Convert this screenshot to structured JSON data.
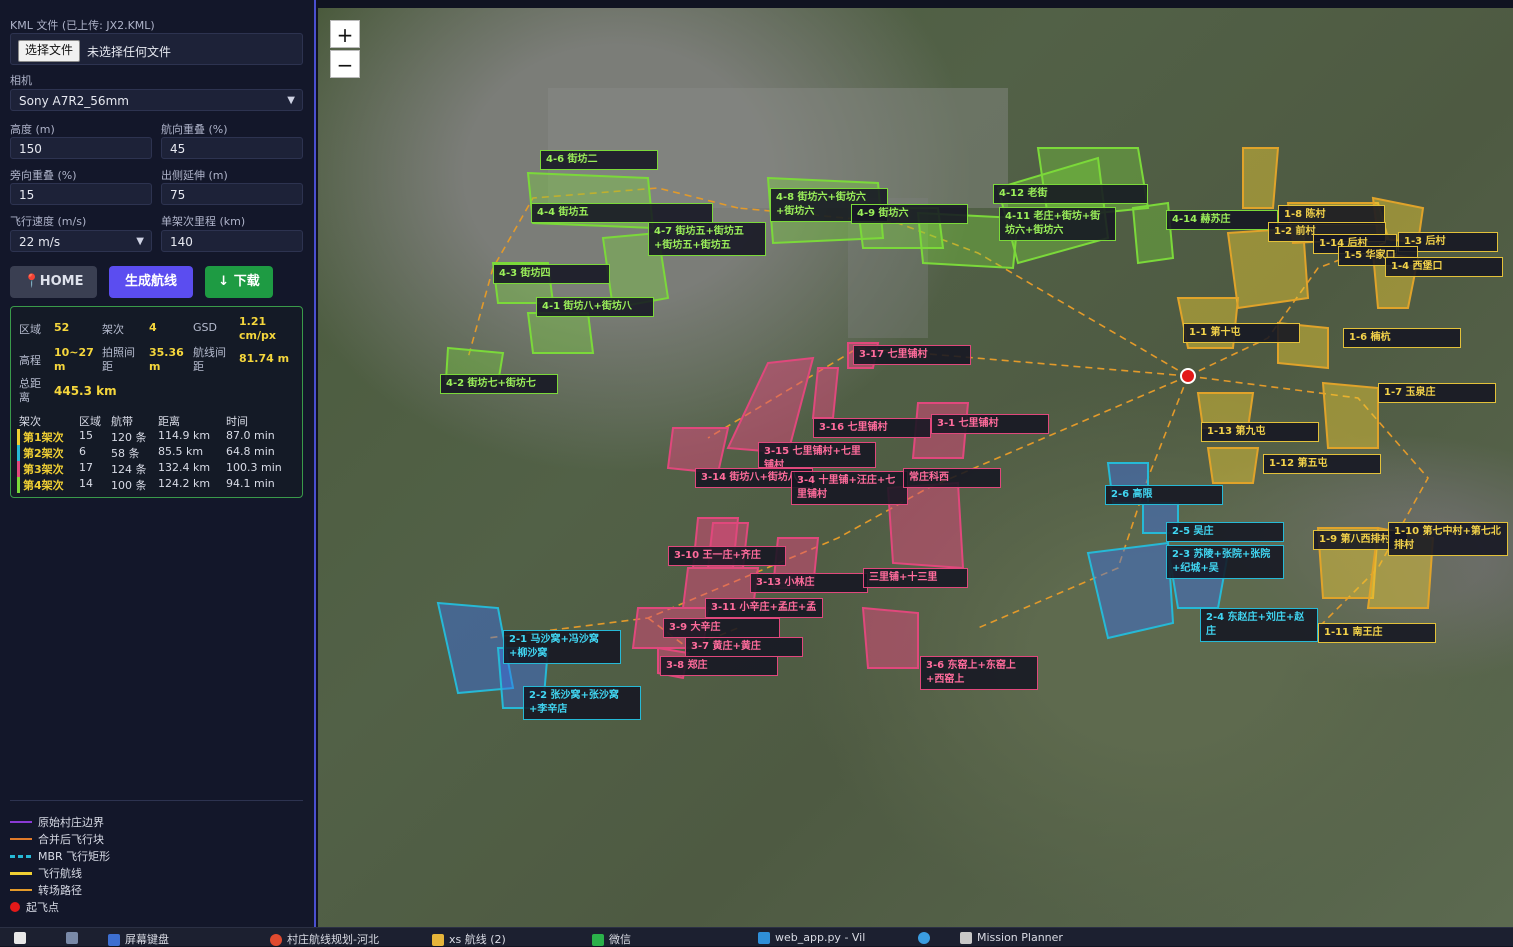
{
  "sidebar": {
    "kml_label": "KML 文件 (已上传: JX2.KML)",
    "file_button": "选择文件",
    "file_status": "未选择任何文件",
    "camera_label": "相机",
    "camera_value": "Sony A7R2_56mm",
    "altitude_label": "高度 (m)",
    "altitude_value": "150",
    "forward_overlap_label": "航向重叠 (%)",
    "forward_overlap_value": "45",
    "side_overlap_label": "旁向重叠 (%)",
    "side_overlap_value": "15",
    "extension_label": "出侧延伸 (m)",
    "extension_value": "75",
    "speed_label": "飞行速度 (m/s)",
    "speed_value": "22 m/s",
    "range_label": "单架次里程 (km)",
    "range_value": "140",
    "home_button": "HOME",
    "generate_button": "生成航线",
    "download_button": "↓ 下载"
  },
  "stats": {
    "zones_label": "区域",
    "zones_value": "52",
    "sorties_label": "架次",
    "sorties_value": "4",
    "gsd_label": "GSD",
    "gsd_value": "1.21 cm/px",
    "height_label": "高程",
    "height_value": "10~27 m",
    "photo_interval_label": "拍照间距",
    "photo_interval_value": "35.36 m",
    "line_spacing_label": "航线间距",
    "line_spacing_value": "81.74 m",
    "total_label": "总距离",
    "total_value": "445.3 km",
    "table_headers": [
      "架次",
      "区域",
      "航带",
      "距离",
      "时间"
    ],
    "rows": [
      {
        "name": "第1架次",
        "zones": "15",
        "strips": "120 条",
        "distance": "114.9 km",
        "time": "87.0 min",
        "color": "#f0cf33"
      },
      {
        "name": "第2架次",
        "zones": "6",
        "strips": "58 条",
        "distance": "85.5 km",
        "time": "64.8 min",
        "color": "#26b9d6"
      },
      {
        "name": "第3架次",
        "zones": "17",
        "strips": "124 条",
        "distance": "132.4 km",
        "time": "100.3 min",
        "color": "#e0487c"
      },
      {
        "name": "第4架次",
        "zones": "14",
        "strips": "100 条",
        "distance": "124.2 km",
        "time": "94.1 min",
        "color": "#7bd93a"
      }
    ]
  },
  "legend": [
    {
      "label": "原始村庄边界",
      "color": "#8a3ad6"
    },
    {
      "label": "合并后飞行块",
      "color": "#e07a2a"
    },
    {
      "label": "MBR 飞行矩形",
      "color": "#26b9d6"
    },
    {
      "label": "飞行航线",
      "color": "#f0cf33"
    },
    {
      "label": "转场路径",
      "color": "#e39a2a"
    },
    {
      "label": "起飞点",
      "color": "#e31919"
    }
  ],
  "map": {
    "zoom_in": "+",
    "zoom_out": "−",
    "labels": [
      {
        "text": "4-6 街坊二",
        "c": "g"
      },
      {
        "text": "4-4 街坊五",
        "c": "g"
      },
      {
        "text": "4-7 街坊五+街坊五+街坊五+街坊五",
        "c": "g"
      },
      {
        "text": "4-8 街坊六+街坊六+街坊六",
        "c": "g"
      },
      {
        "text": "4-9 街坊六",
        "c": "g"
      },
      {
        "text": "4-12 老街",
        "c": "g"
      },
      {
        "text": "4-11 老庄+街坊+街坊六+街坊六",
        "c": "g"
      },
      {
        "text": "4-14 赫苏庄",
        "c": "g"
      },
      {
        "text": "4-3 街坊四",
        "c": "g"
      },
      {
        "text": "4-1 街坊八+街坊八",
        "c": "g"
      },
      {
        "text": "4-2 街坊七+街坊七",
        "c": "g"
      },
      {
        "text": "1-8 陈村",
        "c": "y"
      },
      {
        "text": "1-2 前村",
        "c": "y"
      },
      {
        "text": "1-14 后村",
        "c": "y"
      },
      {
        "text": "1-3 后村",
        "c": "y"
      },
      {
        "text": "1-5 华家口",
        "c": "y"
      },
      {
        "text": "1-4 西堡口",
        "c": "y"
      },
      {
        "text": "1-1 第十屯",
        "c": "y"
      },
      {
        "text": "1-6 楠杭",
        "c": "y"
      },
      {
        "text": "1-7 玉泉庄",
        "c": "y"
      },
      {
        "text": "1-13 第九屯",
        "c": "y"
      },
      {
        "text": "1-12 第五屯",
        "c": "y"
      },
      {
        "text": "1-9 第八西排村",
        "c": "y"
      },
      {
        "text": "1-10 第七中村+第七北排村",
        "c": "y"
      },
      {
        "text": "1-11 南王庄",
        "c": "y"
      },
      {
        "text": "3-17 七里铺村",
        "c": "p"
      },
      {
        "text": "3-16 七里铺村",
        "c": "p"
      },
      {
        "text": "3-1 七里铺村",
        "c": "p"
      },
      {
        "text": "3-15 七里铺村+七里铺村",
        "c": "p"
      },
      {
        "text": "3-14 街坊八+街坊八",
        "c": "p"
      },
      {
        "text": "3-4 十里铺+汪庄+七里铺村",
        "c": "p"
      },
      {
        "text": "常庄科西",
        "c": "p"
      },
      {
        "text": "3-10 王一庄+齐庄",
        "c": "p"
      },
      {
        "text": "3-13 小林庄",
        "c": "p"
      },
      {
        "text": "三里铺+十三里",
        "c": "p"
      },
      {
        "text": "3-11 小辛庄+孟庄+孟",
        "c": "p"
      },
      {
        "text": "3-9 大辛庄",
        "c": "p"
      },
      {
        "text": "3-7 黄庄+黄庄",
        "c": "p"
      },
      {
        "text": "3-8 郑庄",
        "c": "p"
      },
      {
        "text": "3-6 东窑上+东窑上+西窑上",
        "c": "p"
      },
      {
        "text": "2-6 高限",
        "c": "c"
      },
      {
        "text": "2-5 吴庄",
        "c": "c"
      },
      {
        "text": "2-3 苏陵+张院+张院+纪城+吴",
        "c": "c"
      },
      {
        "text": "2-4 东赵庄+刘庄+赵庄",
        "c": "c"
      },
      {
        "text": "2-1 马沙窝+冯沙窝+柳沙窝",
        "c": "c"
      },
      {
        "text": "2-2 张沙窝+张沙窝+李辛店",
        "c": "c"
      }
    ]
  },
  "taskbar": {
    "items": [
      "屏幕键盘",
      "村庄航线规划-河北",
      "xs 航线 (2)",
      "微信",
      "web_app.py - Vil",
      "Mission Planner"
    ]
  }
}
